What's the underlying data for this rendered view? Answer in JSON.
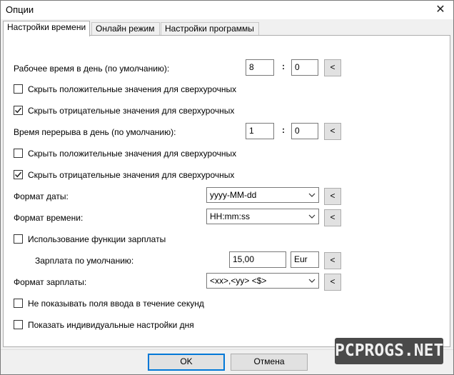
{
  "window": {
    "title": "Опции",
    "close_glyph": "✕"
  },
  "tabs": [
    {
      "label": "Настройки времени",
      "active": true
    },
    {
      "label": "Онлайн режим",
      "active": false
    },
    {
      "label": "Настройки программы",
      "active": false
    }
  ],
  "work_time": {
    "label": "Рабочее время в день (по умолчанию):",
    "hours": "8",
    "separator": ":",
    "minutes": "0",
    "btn": "<"
  },
  "work_checks": [
    {
      "label": "Скрыть положительные значения для сверхурочных",
      "checked": false
    },
    {
      "label": "Скрыть отрицательные значения для сверхурочных",
      "checked": true
    }
  ],
  "break_time": {
    "label": "Время перерыва в день (по умолчанию):",
    "hours": "1",
    "separator": ":",
    "minutes": "0",
    "btn": "<"
  },
  "break_checks": [
    {
      "label": "Скрыть положительные значения для сверхурочных",
      "checked": false
    },
    {
      "label": "Скрыть отрицательные значения для сверхурочных",
      "checked": true
    }
  ],
  "date_format": {
    "label": "Формат даты:",
    "value": "yyyy-MM-dd",
    "btn": "<"
  },
  "time_format": {
    "label": "Формат времени:",
    "value": "HH:mm:ss",
    "btn": "<"
  },
  "salary_func": {
    "label": "Использование функции зарплаты",
    "checked": false
  },
  "salary_default": {
    "label": "Зарплата по умолчанию:",
    "value": "15,00",
    "currency": "Eur",
    "btn": "<"
  },
  "salary_format": {
    "label": "Формат зарплаты:",
    "value": "<xx>,<yy> <$>",
    "btn": "<"
  },
  "extra_checks": [
    {
      "label": "Не показывать поля ввода в течение секунд",
      "checked": false
    },
    {
      "label": "Показать индивидуальные настройки дня",
      "checked": false
    }
  ],
  "footer": {
    "ok": "OK",
    "cancel": "Отмена"
  },
  "watermark": "PCPROGS.NET"
}
